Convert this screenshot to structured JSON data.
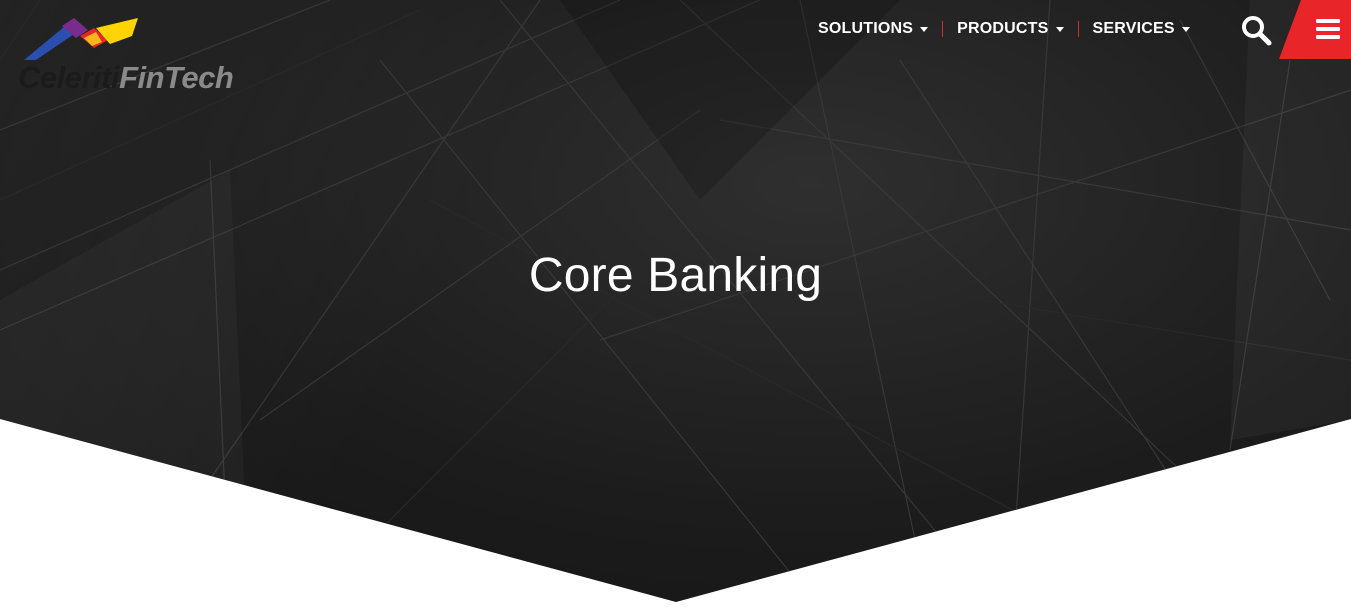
{
  "brand": {
    "name_part1": "Celeriti",
    "name_part2": "FinTech",
    "logo_colors": [
      "#2a4fb0",
      "#7a2b8e",
      "#e8262a",
      "#f5b71c",
      "#ffd400"
    ]
  },
  "nav": {
    "items": [
      {
        "label": "SOLUTIONS"
      },
      {
        "label": "PRODUCTS"
      },
      {
        "label": "SERVICES"
      }
    ],
    "separator_color": "#e3262a",
    "search_icon": "search-icon",
    "menu_icon": "hamburger-menu-icon",
    "menu_button_color": "#e8262a"
  },
  "hero": {
    "title": "Core Banking",
    "background": "dark architectural glass facade photo"
  }
}
